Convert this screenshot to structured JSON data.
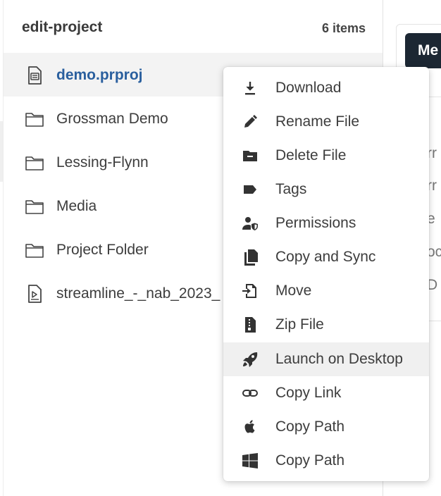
{
  "panel": {
    "title": "edit-project",
    "count": "6 items",
    "files": [
      {
        "name": "demo.prproj",
        "icon": "premiere-project-icon",
        "selected": true
      },
      {
        "name": "Grossman Demo",
        "icon": "folder-icon"
      },
      {
        "name": "Lessing-Flynn",
        "icon": "folder-icon"
      },
      {
        "name": "Media",
        "icon": "folder-icon"
      },
      {
        "name": "Project Folder",
        "icon": "folder-icon"
      },
      {
        "name": "streamline_-_nab_2023_",
        "icon": "video-file-icon"
      }
    ]
  },
  "right_pane": {
    "button_label": "Me",
    "row_fragments": [
      "rr",
      "rr",
      "e",
      "oc",
      "D"
    ]
  },
  "context_menu": {
    "items": [
      {
        "label": "Download",
        "icon": "download-icon"
      },
      {
        "label": "Rename File",
        "icon": "pencil-icon"
      },
      {
        "label": "Delete File",
        "icon": "folder-minus-icon"
      },
      {
        "label": "Tags",
        "icon": "tag-icon"
      },
      {
        "label": "Permissions",
        "icon": "user-shield-icon"
      },
      {
        "label": "Copy and Sync",
        "icon": "copy-icon"
      },
      {
        "label": "Move",
        "icon": "move-file-icon"
      },
      {
        "label": "Zip File",
        "icon": "zip-file-icon"
      },
      {
        "label": "Launch on Desktop",
        "icon": "rocket-icon",
        "hovered": true
      },
      {
        "label": "Copy Link",
        "icon": "link-icon"
      },
      {
        "label": "Copy Path",
        "icon": "apple-icon"
      },
      {
        "label": "Copy Path",
        "icon": "windows-icon"
      }
    ]
  },
  "colors": {
    "selected_text": "#2a5f9e",
    "dark_button": "#1c2733",
    "hover_bg": "#f0f0f0"
  }
}
